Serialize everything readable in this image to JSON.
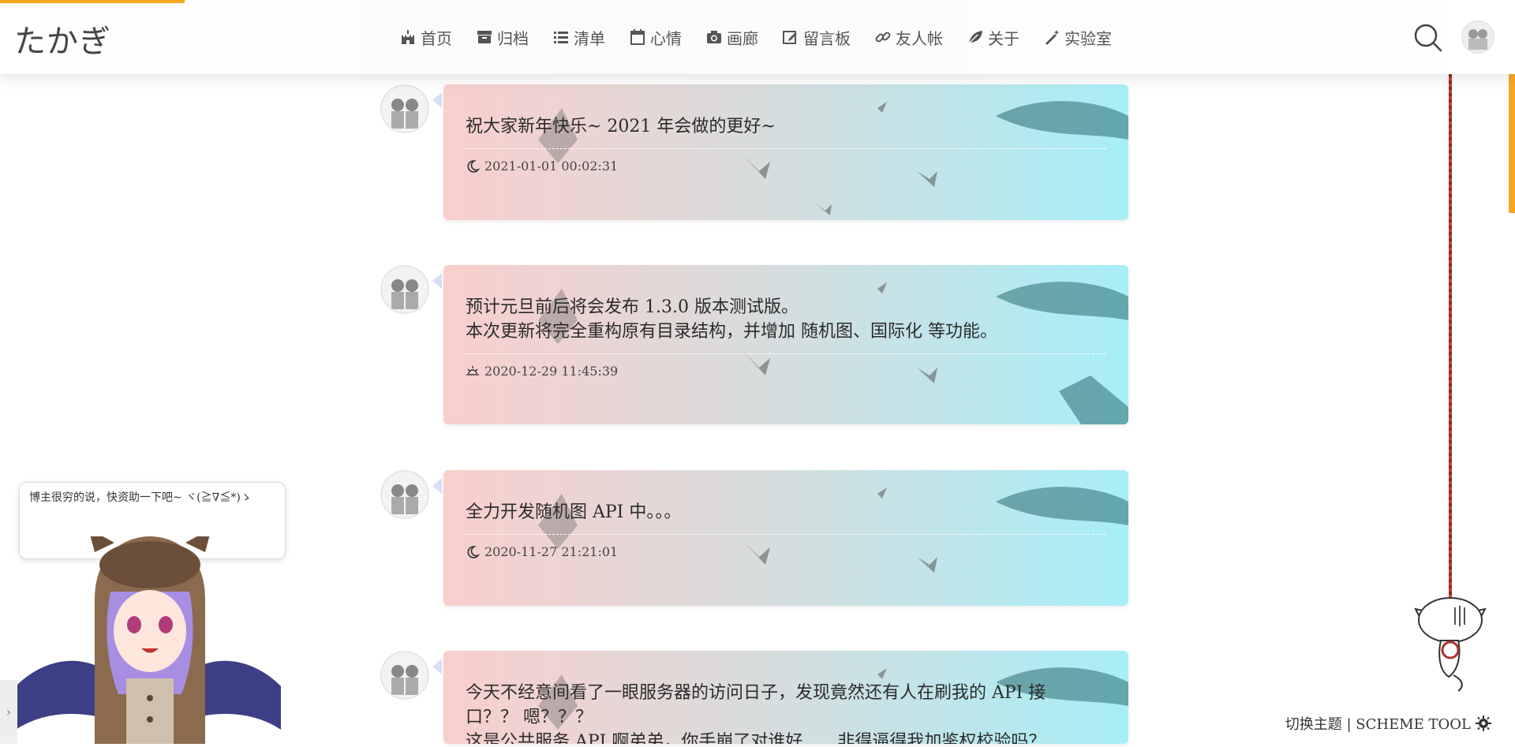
{
  "site": {
    "logo": "たかぎ"
  },
  "nav": [
    {
      "label": "首页",
      "icon": "castle-icon"
    },
    {
      "label": "归档",
      "icon": "archive-icon"
    },
    {
      "label": "清单",
      "icon": "list-icon"
    },
    {
      "label": "心情",
      "icon": "calendar-icon"
    },
    {
      "label": "画廊",
      "icon": "camera-icon"
    },
    {
      "label": "留言板",
      "icon": "edit-icon"
    },
    {
      "label": "友人帐",
      "icon": "link-icon"
    },
    {
      "label": "关于",
      "icon": "leaf-icon"
    },
    {
      "label": "实验室",
      "icon": "magic-wand-icon"
    }
  ],
  "entries": [
    {
      "lines": [
        "祝大家新年快乐~ 2021 年会做的更好~"
      ],
      "time": "2021-01-01 00:02:31",
      "time_icon": "moon-icon"
    },
    {
      "lines": [
        "预计元旦前后将会发布 1.3.0 版本测试版。",
        "本次更新将完全重构原有目录结构，并增加 随机图、国际化 等功能。"
      ],
      "time": "2020-12-29 11:45:39",
      "time_icon": "sunrise-icon"
    },
    {
      "lines": [
        "全力开发随机图 API 中。。。"
      ],
      "time": "2020-11-27 21:21:01",
      "time_icon": "moon-icon"
    },
    {
      "lines": [
        "今天不经意间看了一眼服务器的访问日子，发现竟然还有人在刷我的 API 接",
        "口？？ 嗯？？？",
        "这是公共服务 API 啊弟弟，你手崩了对谁好……非得逼得我加鉴权校验吗？"
      ],
      "time": "",
      "time_icon": ""
    }
  ],
  "widget": {
    "speech": "博主很穷的说，快资助一下吧~ ヾ(≧∇≦*)ゝ",
    "scheme_tool": "切换主题 | SCHEME TOOL"
  },
  "colors": {
    "accent": "#f5a623",
    "card_left": "#f9cfcc",
    "card_right": "#a7eef7"
  }
}
